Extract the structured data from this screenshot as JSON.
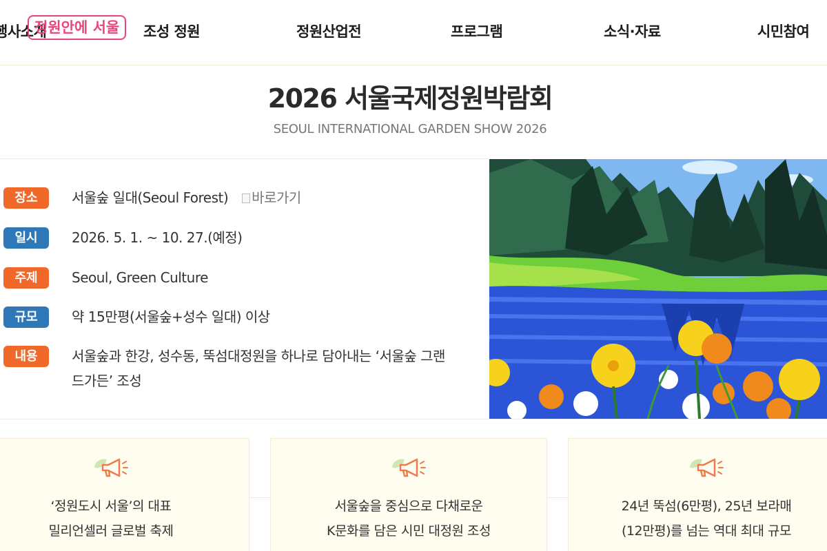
{
  "nav": {
    "items": [
      {
        "label": "행사소개"
      },
      {
        "label": "조성 정원"
      },
      {
        "label": "정원산업전"
      },
      {
        "label": "프로그램"
      },
      {
        "label": "소식·자료"
      },
      {
        "label": "시민참여"
      }
    ],
    "badge": "정원안에 서울"
  },
  "header": {
    "title": "2026 서울국제정원박람회",
    "subtitle": "SEOUL INTERNATIONAL GARDEN SHOW 2026"
  },
  "info": [
    {
      "tag": "장소",
      "color": "orange",
      "value": "서울숲 일대(Seoul Forest)",
      "link_alt": "바로가기"
    },
    {
      "tag": "일시",
      "color": "blue",
      "value": "2026. 5. 1. ~ 10. 27.(예정)"
    },
    {
      "tag": "주제",
      "color": "orange",
      "value": "Seoul, Green Culture"
    },
    {
      "tag": "규모",
      "color": "blue",
      "value": "약 15만평(서울숲+성수 일대) 이상"
    },
    {
      "tag": "내용",
      "color": "orange",
      "value": "서울숲과 한강, 성수동, 뚝섬대정원을 하나로 담아내는 ‘서울숲 그랜드가든’ 조성"
    }
  ],
  "cards": [
    {
      "icon": "megaphone-icon",
      "line1": "‘정원도시 서울’의 대표",
      "line2": "밀리언셀러 글로벌 축제"
    },
    {
      "icon": "megaphone-icon",
      "line1": "서울숲을 중심으로 다채로운",
      "line2": "K문화를 담은 시민 대정원 조성"
    },
    {
      "icon": "megaphone-icon",
      "line1": "24년 뚝섬(6만평), 25년 보라매",
      "line2": "(12만평)를 넘는 역대 최대 규모"
    }
  ],
  "colors": {
    "tag_orange": "#f0692a",
    "tag_blue": "#2f78b8",
    "badge_pink": "#e8467a",
    "card_bg": "#fffdf0"
  }
}
